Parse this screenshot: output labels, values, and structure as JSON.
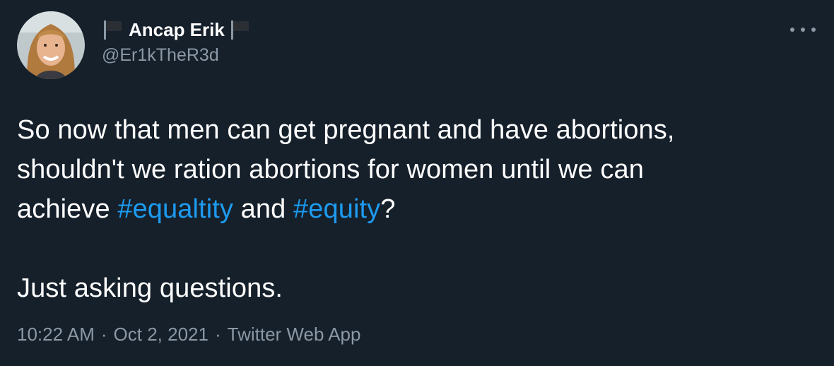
{
  "tweet": {
    "display_name": "Ancap Erik",
    "handle": "@Er1kTheR3d",
    "more_icon": "more-horizontal-icon",
    "flag_icon": "black-flag-icon",
    "text": {
      "line1": "So now that men can get pregnant and have abortions,",
      "line2": "shouldn't we ration abortions for women until we can",
      "line3_prefix": "achieve ",
      "hashtag1": "#equaltity",
      "line3_middle": " and ",
      "hashtag2": "#equity",
      "line3_suffix": "?",
      "line4": "Just asking questions."
    },
    "meta": {
      "time": "10:22 AM",
      "sep": "·",
      "date": "Oct 2, 2021",
      "source": "Twitter Web App"
    }
  },
  "colors": {
    "background": "#15202b",
    "text": "#ffffff",
    "muted": "#8b98a5",
    "link": "#1d9bf0"
  }
}
